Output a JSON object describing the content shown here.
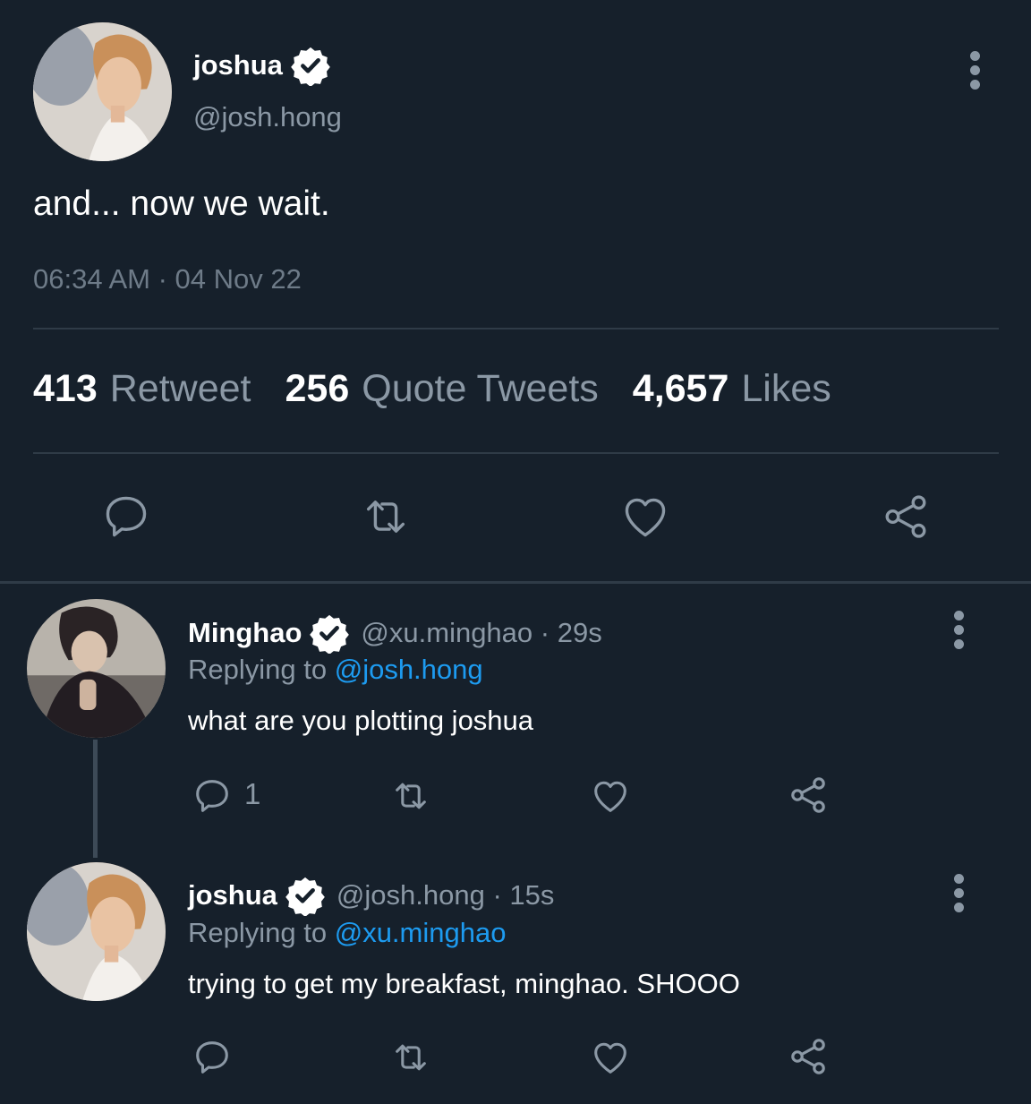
{
  "main_tweet": {
    "author": {
      "name": "joshua",
      "handle": "@josh.hong",
      "verified": true
    },
    "text": "and... now we wait.",
    "timestamp": "06:34 AM · 04 Nov 22",
    "stats": [
      {
        "count": "413",
        "label": "Retweet"
      },
      {
        "count": "256",
        "label": "Quote Tweets"
      },
      {
        "count": "4,657",
        "label": "Likes"
      }
    ],
    "actions": [
      "reply-icon",
      "retweet-icon",
      "like-icon",
      "share-icon"
    ]
  },
  "replies": [
    {
      "name": "Minghao",
      "handle": "@xu.minghao",
      "time_sep": " · ",
      "time": "29s",
      "verified": true,
      "replying_prefix": "Replying to ",
      "replying_to": "@josh.hong",
      "text": "what are you plotting joshua",
      "reply_count": "1"
    },
    {
      "name": "joshua",
      "handle": "@josh.hong",
      "time_sep": " · ",
      "time": "15s",
      "verified": true,
      "replying_prefix": "Replying to ",
      "replying_to": "@xu.minghao",
      "text": "trying to get my breakfast, minghao. SHOOO",
      "reply_count": ""
    }
  ],
  "colors": {
    "background": "#16202b",
    "muted_text": "#8b98a5",
    "link": "#1d9bf0",
    "divider": "#2f3b47"
  }
}
